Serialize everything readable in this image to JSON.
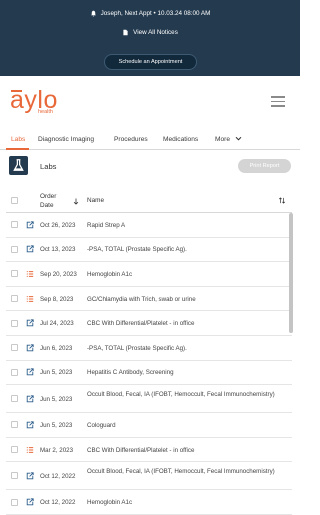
{
  "notices": {
    "appointment": "Joseph, Next Appt • 10.03.24 08:00 AM",
    "view_all": "View All Notices",
    "schedule_button": "Schedule an Appointment"
  },
  "brand": {
    "name": "aylo",
    "sub": "health",
    "accent_color": "#e8683a",
    "dark_color": "#243a4f"
  },
  "tabs": [
    {
      "label": "Labs",
      "active": true
    },
    {
      "label": "Diagnostic Imaging"
    },
    {
      "label": "Procedures"
    },
    {
      "label": "Medications"
    },
    {
      "label": "More"
    }
  ],
  "section": {
    "title": "Labs",
    "print_button": "Print Report"
  },
  "table": {
    "headers": {
      "order_date_1": "Order",
      "order_date_2": "Date",
      "name": "Name"
    },
    "rows": [
      {
        "icon": "external-link-icon",
        "date": "Oct 26, 2023",
        "name": "Rapid Strep A"
      },
      {
        "icon": "external-link-icon",
        "date": "Oct 13, 2023",
        "name": "-PSA, TOTAL (Prostate Specific Ag)."
      },
      {
        "icon": "list-icon",
        "date": "Sep 20, 2023",
        "name": "Hemoglobin A1c"
      },
      {
        "icon": "list-icon",
        "date": "Sep 8, 2023",
        "name": "GC/Chlamydia with Trich, swab or urine"
      },
      {
        "icon": "external-link-icon",
        "date": "Jul 24, 2023",
        "name": "CBC With Differential/Platelet - in office"
      },
      {
        "icon": "external-link-icon",
        "date": "Jun 6, 2023",
        "name": "-PSA, TOTAL (Prostate Specific Ag)."
      },
      {
        "icon": "external-link-icon",
        "date": "Jun 5, 2023",
        "name": "Hepatitis C Antibody, Screening"
      },
      {
        "icon": "external-link-icon",
        "date": "Jun 5, 2023",
        "name": "Occult Blood, Fecal, IA (IFOBT, Hemoccult, Fecal Immunochemistry)"
      },
      {
        "icon": "external-link-icon",
        "date": "Jun 5, 2023",
        "name": "Cologuard"
      },
      {
        "icon": "list-icon",
        "date": "Mar 2, 2023",
        "name": "CBC With Differential/Platelet - in office"
      },
      {
        "icon": "external-link-icon",
        "date": "Oct 12, 2022",
        "name": "Occult Blood, Fecal, IA (IFOBT, Hemoccult, Fecal Immunochemistry)"
      },
      {
        "icon": "external-link-icon",
        "date": "Oct 12, 2022",
        "name": "Hemoglobin A1c"
      }
    ]
  }
}
